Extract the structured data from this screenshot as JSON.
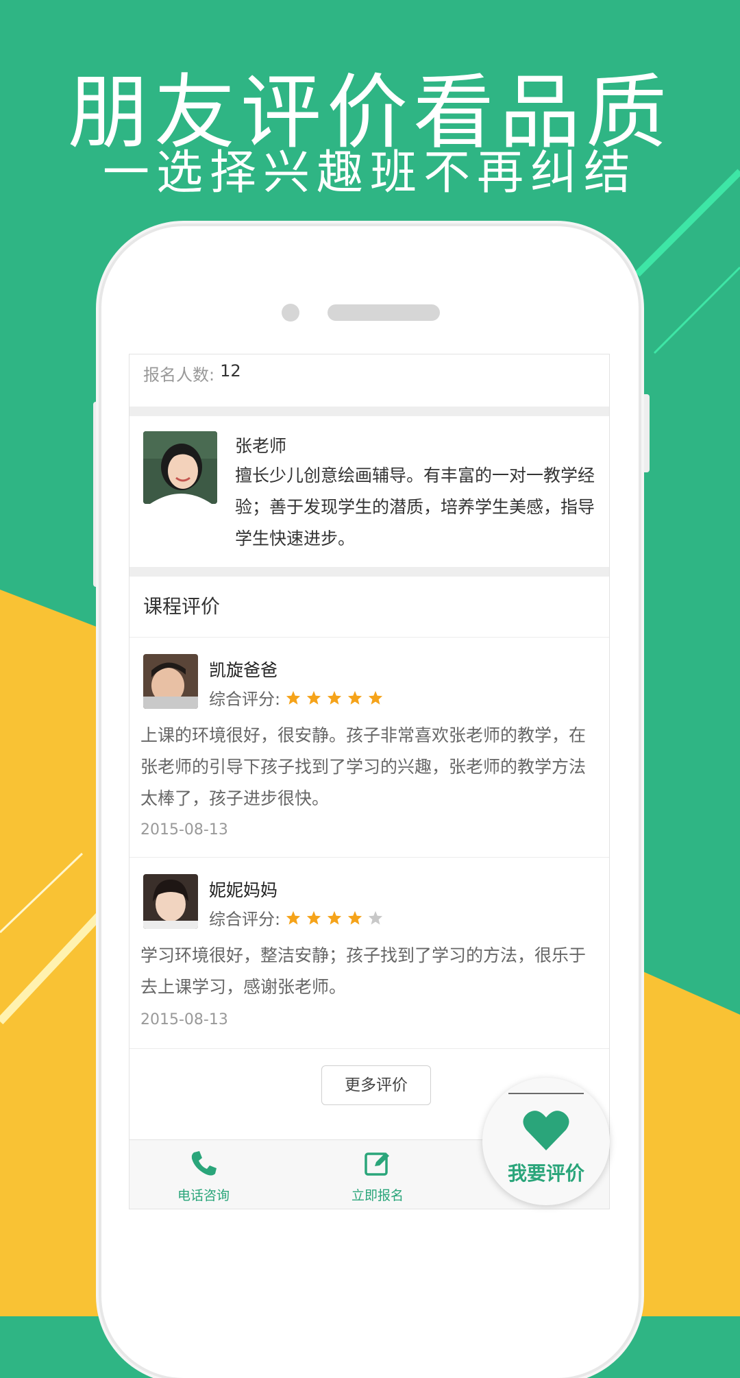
{
  "banner": {
    "title": "朋友评价看品质",
    "subtitle": "一选择兴趣班不再纠结"
  },
  "colors": {
    "green_bg": "#2fb584",
    "yellow_bg": "#f9c234",
    "accent_green": "#2aa57a",
    "star_orange": "#f5a31a",
    "star_gray": "#c8c8c8"
  },
  "course": {
    "enroll_label": "报名人数:",
    "enroll_count": "12"
  },
  "teacher": {
    "name": "张老师",
    "description": "擅长少儿创意绘画辅导。有丰富的一对一教学经验；善于发现学生的潜质，培养学生美感，指导学生快速进步。"
  },
  "reviews_section": {
    "title": "课程评价",
    "score_label": "综合评分:",
    "more_button": "更多评价"
  },
  "reviews": [
    {
      "author": "凯旋爸爸",
      "rating": 5,
      "text": "上课的环境很好，很安静。孩子非常喜欢张老师的教学，在张老师的引导下孩子找到了学习的兴趣，张老师的教学方法太棒了，孩子进步很快。",
      "date": "2015-08-13"
    },
    {
      "author": "妮妮妈妈",
      "rating": 4,
      "text": "学习环境很好，整洁安静；孩子找到了学习的方法，很乐于去上课学习，感谢张老师。",
      "date": "2015-08-13"
    }
  ],
  "tabbar": {
    "phone_label": "电话咨询",
    "signup_label": "立即报名"
  },
  "fab": {
    "label": "我要评价",
    "icon": "heart-icon"
  }
}
